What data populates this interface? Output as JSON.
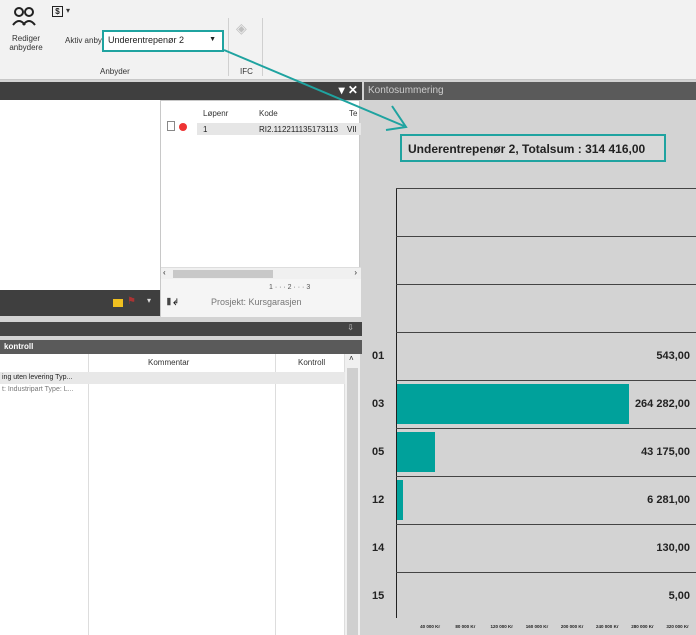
{
  "ribbon": {
    "edit_button_label": "Rediger anbydere",
    "active_bidder_label": "Aktiv anbyder",
    "selected_bidder": "Underentrepenør 2",
    "group_anbyder": "Anbyder",
    "group_ifc": "IFC",
    "currency_icon_label": "$"
  },
  "grid": {
    "headers": [
      "Løpenr",
      "Kode",
      "Te"
    ],
    "rows": [
      {
        "lopenr": "1",
        "kode": "RI2.112211135173113",
        "te": "VII"
      }
    ],
    "project_label": "Prosjekt: Kursgarasjen",
    "ruler": "1 · · · 2 · · · 3"
  },
  "lower_panel": {
    "title": "kontroll",
    "headers": [
      "Kommentar",
      "Kontroll"
    ],
    "rows": [
      "ing uten levering Typ...",
      "t: Industripart Type: L..."
    ]
  },
  "kontosummering": {
    "panel_title": "Kontosummering",
    "title": "Underentrepenør 2, Totalsum : 314 416,00"
  },
  "chart_data": {
    "type": "bar",
    "orientation": "horizontal",
    "title": "Underentrepenør 2, Totalsum : 314 416,00",
    "categories": [
      "01",
      "03",
      "05",
      "12",
      "14",
      "15"
    ],
    "values": [
      543.0,
      264282.0,
      43175.0,
      6281.0,
      130.0,
      5.0
    ],
    "value_labels": [
      "543,00",
      "264 282,00",
      "43 175,00",
      "6 281,00",
      "130,00",
      "5,00"
    ],
    "xlim": [
      0,
      340000
    ],
    "xtick_labels": [
      "40 000 Kr",
      "80 000 Kr",
      "120 000 Kr",
      "160 000 Kr",
      "200 000 Kr",
      "240 000 Kr",
      "280 000 Kr",
      "320 000 Kr"
    ],
    "xticks": [
      40000,
      80000,
      120000,
      160000,
      200000,
      240000,
      280000,
      320000
    ],
    "bar_color": "#00a19b",
    "grid": true
  },
  "colors": {
    "accent": "#1fa3a0",
    "bar": "#00a19b"
  }
}
